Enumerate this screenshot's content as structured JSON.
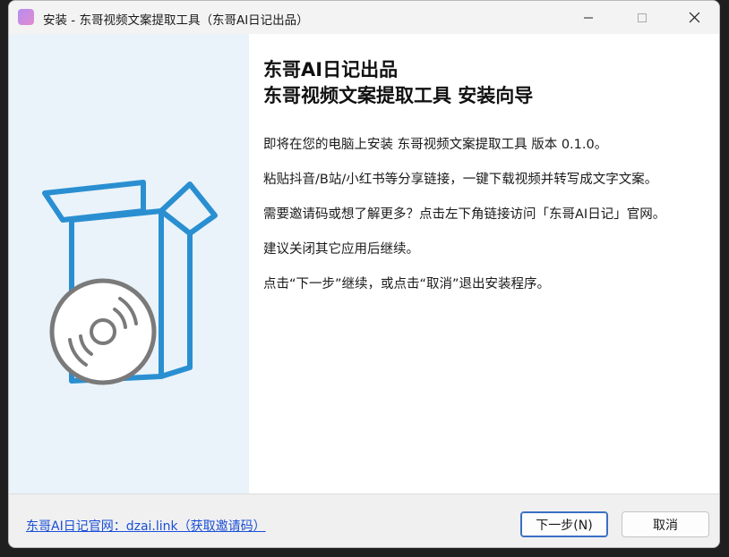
{
  "window": {
    "title": "安装 - 东哥视频文案提取工具（东哥AI日记出品）"
  },
  "icons": {
    "app": "installer-app-icon",
    "minimize": "minimize-icon",
    "maximize": "maximize-icon",
    "close": "close-icon",
    "illustration": "box-with-disc-icon"
  },
  "content": {
    "heading_line1": "东哥AI日记出品",
    "heading_line2": "东哥视频文案提取工具 安装向导",
    "paragraphs": [
      "即将在您的电脑上安装 东哥视频文案提取工具 版本 0.1.0。",
      "粘贴抖音/B站/小红书等分享链接，一键下载视频并转写成文字文案。",
      "需要邀请码或想了解更多？点击左下角链接访问「东哥AI日记」官网。",
      "建议关闭其它应用后继续。",
      "点击“下一步”继续，或点击“取消”退出安装程序。"
    ]
  },
  "footer": {
    "link_text": "东哥AI日记官网：dzai.link（获取邀请码）",
    "next_label": "下一步(N)",
    "cancel_label": "取消"
  },
  "colors": {
    "sidebar_bg": "#eaf3fa",
    "accent_blue": "#2a8fd1",
    "disc_gray": "#7a7a7a",
    "link": "#1a4fd6"
  }
}
